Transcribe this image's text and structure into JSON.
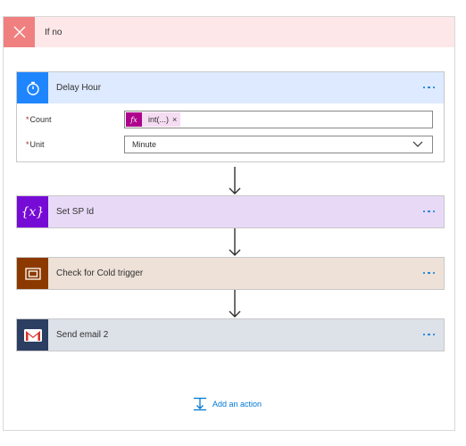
{
  "scope": {
    "title": "If no",
    "close_icon": "close-icon",
    "accent": "#f08080",
    "background": "#fde7e9"
  },
  "delay": {
    "title": "Delay Hour",
    "icon": "timer-icon",
    "color": "#1f85ff",
    "count_label": "Count",
    "count_token": "int(...)",
    "count_token_icon": "fx",
    "count_token_remove": "×",
    "unit_label": "Unit",
    "unit_value": "Minute",
    "required_mark": "*"
  },
  "variable": {
    "title": "Set SP Id",
    "icon": "variable-icon",
    "icon_text": "{x}",
    "color": "#770bd6"
  },
  "condition": {
    "title": "Check for Cold trigger",
    "icon": "condition-icon",
    "color": "#8c3900"
  },
  "email": {
    "title": "Send email 2",
    "icon": "gmail-icon",
    "color": "#2c3e61"
  },
  "add_action": {
    "label": "Add an action",
    "icon": "add-action-icon"
  }
}
